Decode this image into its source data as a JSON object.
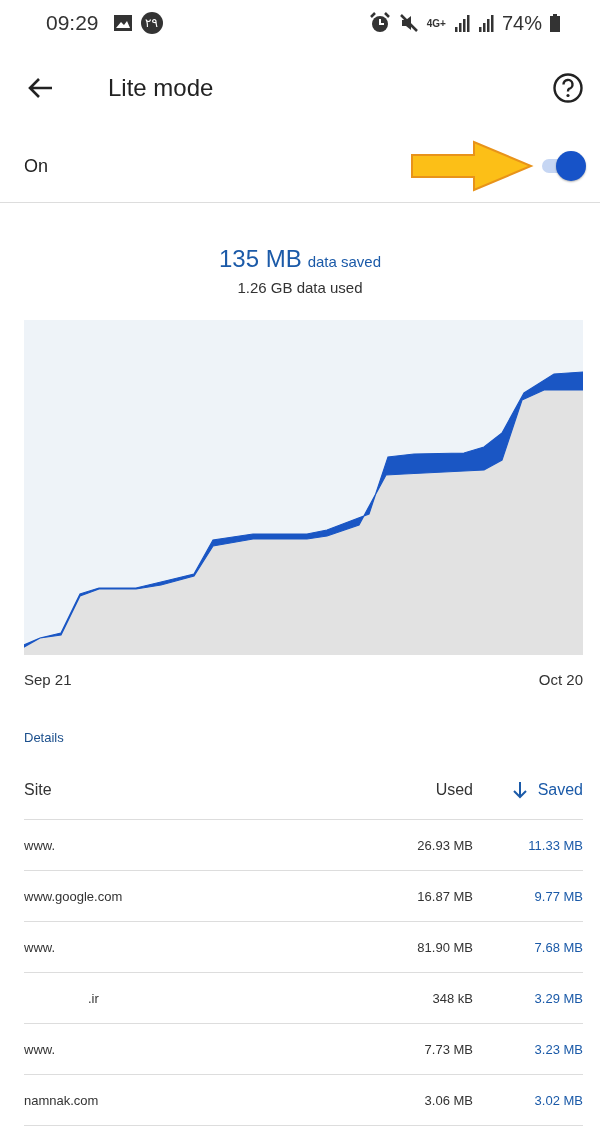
{
  "status_bar": {
    "time": "09:29",
    "notification_badge": "۲۹",
    "network_type": "4G+",
    "battery": "74%"
  },
  "toolbar": {
    "title": "Lite mode"
  },
  "switch_row": {
    "label": "On",
    "on": true
  },
  "summary": {
    "saved_amount": "135 MB",
    "saved_label": "data saved",
    "used": "1.26 GB data used"
  },
  "chart": {
    "start_label": "Sep 21",
    "end_label": "Oct 20"
  },
  "details": {
    "heading": "Details",
    "columns": {
      "site": "Site",
      "used": "Used",
      "saved": "Saved"
    },
    "rows": [
      {
        "site": "www.",
        "used": "26.93 MB",
        "saved": "11.33 MB"
      },
      {
        "site": "www.google.com",
        "used": "16.87 MB",
        "saved": "9.77 MB"
      },
      {
        "site": "www.",
        "used": "81.90 MB",
        "saved": "7.68 MB"
      },
      {
        "site": ".ir",
        "used": "348 kB",
        "saved": "3.29 MB"
      },
      {
        "site": "www.",
        "used": "7.73 MB",
        "saved": "3.23 MB"
      },
      {
        "site": "namnak.com",
        "used": "3.06 MB",
        "saved": "3.02 MB"
      }
    ]
  }
}
